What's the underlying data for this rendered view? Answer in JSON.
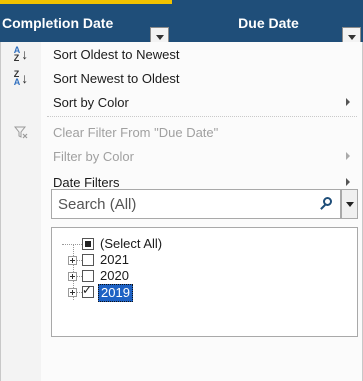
{
  "header": {
    "completion_date_label": "Completion Date",
    "due_date_label": "Due Date"
  },
  "menu": {
    "sort_oldest": "Sort Oldest to Newest",
    "sort_newest": "Sort Newest to Oldest",
    "sort_by_color": "Sort by Color",
    "clear_filter": "Clear Filter From \"Due Date\"",
    "filter_by_color": "Filter by Color",
    "date_filters": "Date Filters"
  },
  "search": {
    "value": "Search (All)"
  },
  "tree": {
    "select_all": "(Select All)",
    "items": [
      {
        "label": "2021",
        "checked": false
      },
      {
        "label": "2020",
        "checked": false
      },
      {
        "label": "2019",
        "checked": true
      }
    ]
  },
  "colors": {
    "header_bg": "#1f4e79",
    "header_accent": "#f2c200",
    "selection": "#1e62c4"
  },
  "icons": [
    "sort-ascending-icon",
    "sort-descending-icon",
    "clear-filter-icon",
    "search-icon",
    "dropdown-arrow-icon",
    "submenu-arrow-icon",
    "tree-expand-icon"
  ]
}
